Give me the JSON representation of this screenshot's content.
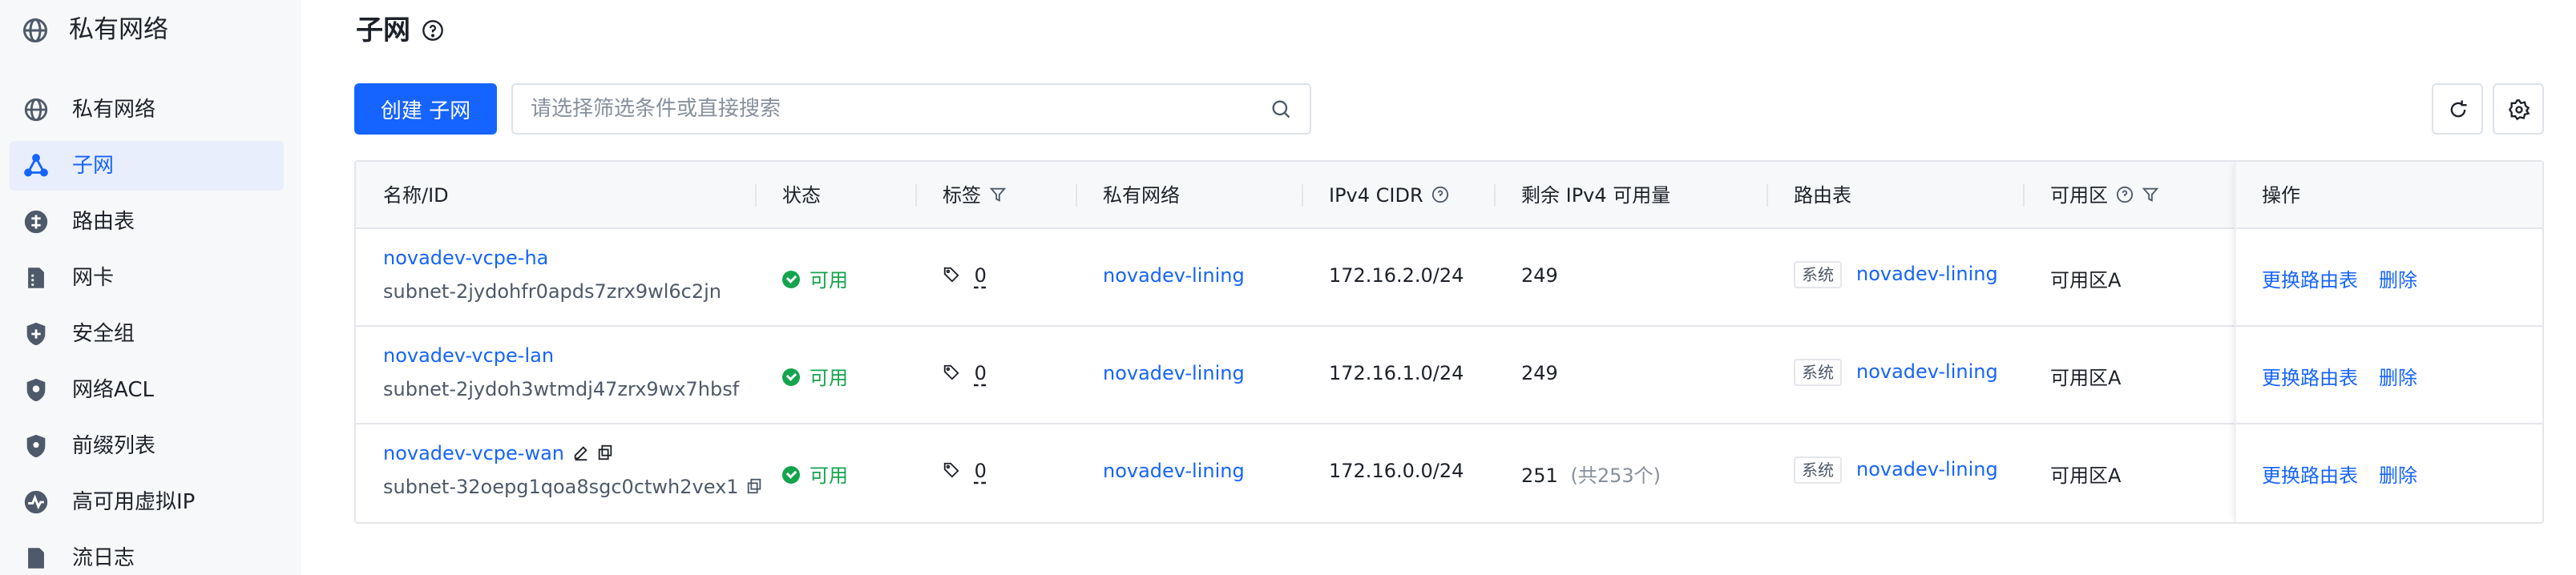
{
  "sidebar": {
    "title": "私有网络",
    "items": [
      {
        "label": "私有网络",
        "icon": "vpc-icon",
        "active": false
      },
      {
        "label": "子网",
        "icon": "subnet-icon",
        "active": true
      },
      {
        "label": "路由表",
        "icon": "route-table-icon",
        "active": false
      },
      {
        "label": "网卡",
        "icon": "nic-icon",
        "active": false
      },
      {
        "label": "安全组",
        "icon": "security-group-icon",
        "active": false
      },
      {
        "label": "网络ACL",
        "icon": "network-acl-icon",
        "active": false
      },
      {
        "label": "前缀列表",
        "icon": "prefix-list-icon",
        "active": false
      },
      {
        "label": "高可用虚拟IP",
        "icon": "ha-vip-icon",
        "active": false
      },
      {
        "label": "流日志",
        "icon": "flow-log-icon",
        "active": false
      }
    ]
  },
  "page": {
    "title": "子网"
  },
  "toolbar": {
    "create_label": "创建 子网",
    "search_placeholder": "请选择筛选条件或直接搜索"
  },
  "table": {
    "headers": {
      "name": "名称/ID",
      "status": "状态",
      "tags": "标签",
      "vpc": "私有网络",
      "cidr": "IPv4 CIDR",
      "available": "剩余 IPv4 可用量",
      "route_table": "路由表",
      "zone": "可用区",
      "actions": "操作"
    },
    "rows": [
      {
        "name": "novadev-vcpe-ha",
        "id": "subnet-2jydohfr0apds7zrx9wl6c2jn",
        "status": "可用",
        "tag_count": "0",
        "vpc": "novadev-lining",
        "cidr": "172.16.2.0/24",
        "available": "249",
        "available_total": "",
        "route_badge": "系统",
        "route_table": "novadev-lining",
        "zone": "可用区A",
        "action_change": "更换路由表",
        "action_delete": "删除"
      },
      {
        "name": "novadev-vcpe-lan",
        "id": "subnet-2jydoh3wtmdj47zrx9wx7hbsf",
        "status": "可用",
        "tag_count": "0",
        "vpc": "novadev-lining",
        "cidr": "172.16.1.0/24",
        "available": "249",
        "available_total": "",
        "route_badge": "系统",
        "route_table": "novadev-lining",
        "zone": "可用区A",
        "action_change": "更换路由表",
        "action_delete": "删除"
      },
      {
        "name": "novadev-vcpe-wan",
        "id": "subnet-32oepg1qoa8sgc0ctwh2vex1",
        "status": "可用",
        "tag_count": "0",
        "vpc": "novadev-lining",
        "cidr": "172.16.0.0/24",
        "available": "251",
        "available_total": "(共253个)",
        "route_badge": "系统",
        "route_table": "novadev-lining",
        "zone": "可用区A",
        "action_change": "更换路由表",
        "action_delete": "删除"
      }
    ]
  },
  "colors": {
    "accent": "#1664ff",
    "success": "#14a44d",
    "sidebar_bg": "#f7f8fa",
    "active_bg": "#e8eefc"
  }
}
